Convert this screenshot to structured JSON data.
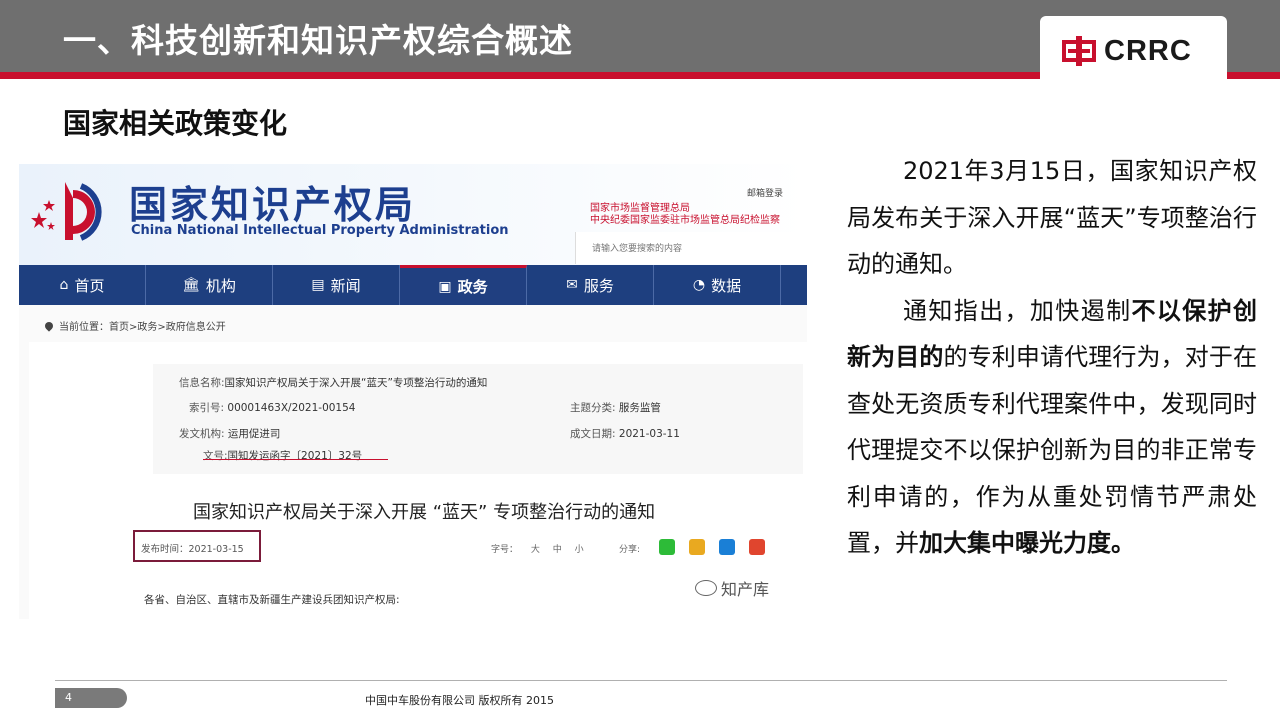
{
  "header": {
    "title": "一、科技创新和知识产权综合概述",
    "logo_text": "CRRC"
  },
  "subtitle": "国家相关政策变化",
  "screenshot": {
    "site_name_cn": "国家知识产权局",
    "site_name_en": "China National Intellectual Property Administration",
    "login": "邮箱登录",
    "samr_line1": "国家市场监督管理总局",
    "samr_line2": "中央纪委国家监委驻市场监管总局纪检监察",
    "search_placeholder": "请输入您要搜索的内容",
    "nav": [
      {
        "icon": "⌂",
        "label": "首页"
      },
      {
        "icon": "🏛",
        "label": "机构"
      },
      {
        "icon": "▤",
        "label": "新闻"
      },
      {
        "icon": "▣",
        "label": "政务"
      },
      {
        "icon": "✉",
        "label": "服务"
      },
      {
        "icon": "◔",
        "label": "数据"
      }
    ],
    "breadcrumb": "当前位置：首页>政务>政府信息公开",
    "info": {
      "name_key": "信息名称:",
      "name_val": "国家知识产权局关于深入开展“蓝天”专项整治行动的通知",
      "index_key": "索引号:",
      "index_val": "00001463X/2021-00154",
      "topic_key": "主题分类:",
      "topic_val": "服务监管",
      "issuer_key": "发文机构:",
      "issuer_val": "运用促进司",
      "date_key": "成文日期:",
      "date_val": "2021-03-11",
      "docno_key": "文号:",
      "docno_val": "国知发运函字〔2021〕32号"
    },
    "doc_title": "国家知识产权局关于深入开展 “蓝天” 专项整治行动的通知",
    "publish_date": "发布时间：2021-03-15",
    "font_ctrl": "字号： 大 中 小",
    "share_label": "分享:",
    "watermark": "知产库",
    "body_start": "各省、自治区、直辖市及新疆生产建设兵团知识产权局:"
  },
  "right_text": {
    "p1": "2021年3月15日，国家知识产权局发布关于深入开展“蓝天”专项整治行动的通知。",
    "p2_a": "通知指出，加快遏制",
    "p2_b": "不以保护创新为目的",
    "p2_c": "的专利申请代理行为，对于在查处无资质专利代理案件中，发现同时代理提交不以保护创新为目的非正常专利申请的，作为从重处罚情节严肃处置，并",
    "p2_d": "加大集中曝光力度。"
  },
  "footer": {
    "page": "4",
    "copyright": "中国中车股份有限公司 版权所有 2015"
  },
  "colors": {
    "header_gray": "#6f6f6f",
    "accent_red": "#c8102e",
    "cnipa_blue": "#1e3f7f"
  }
}
